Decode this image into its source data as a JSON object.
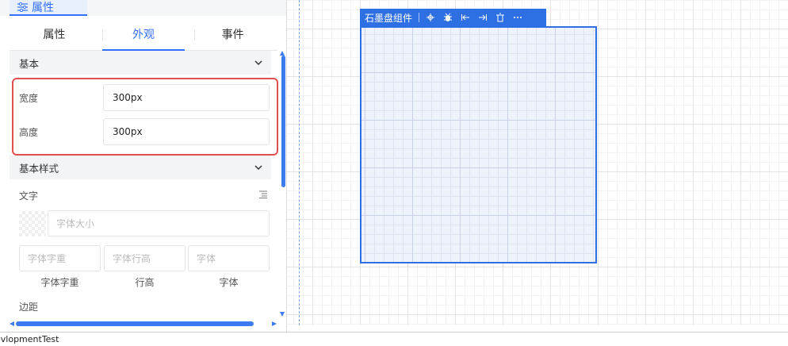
{
  "panel": {
    "header_tab": "属性",
    "tabs": [
      "属性",
      "外观",
      "事件"
    ],
    "active_tab_index": 1
  },
  "sections": {
    "basic": "基本",
    "basic_style": "基本样式"
  },
  "props": {
    "width_label": "宽度",
    "width_value": "300px",
    "height_label": "高度",
    "height_value": "300px"
  },
  "text_section": {
    "label": "文字",
    "font_size_placeholder": "字体大小",
    "font_weight_placeholder": "字体字重",
    "line_height_placeholder": "字体行高",
    "font_family_placeholder": "字体",
    "captions": [
      "字体字重",
      "行高",
      "字体"
    ]
  },
  "margin_label": "边距",
  "component": {
    "title": "石墨盘组件"
  },
  "statusbar": {
    "text": "evlopmentTest"
  },
  "colors": {
    "accent": "#3370ff",
    "highlight_border": "#e05050",
    "component_border": "#2f6fe4"
  }
}
